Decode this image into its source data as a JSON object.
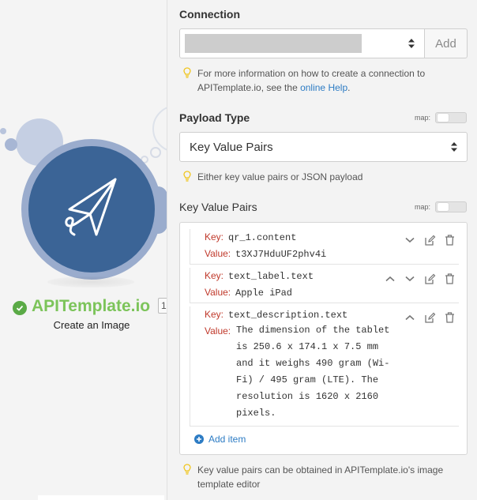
{
  "module": {
    "name": "APITemplate.io",
    "subtitle": "Create an Image",
    "badge": "1",
    "brand_color": "#3b6496",
    "status_color": "#5aaa46",
    "name_color": "#7cc45a"
  },
  "panel": {
    "connection": {
      "label": "Connection",
      "add_label": "Add",
      "hint_prefix": "For more information on how to create a connection to APITemplate.io, see the ",
      "hint_link": "online Help",
      "hint_suffix": "."
    },
    "payload_type": {
      "label": "Payload Type",
      "map_label": "map:",
      "selected": "Key Value Pairs",
      "hint": "Either key value pairs or JSON payload"
    },
    "key_value_pairs": {
      "label": "Key Value Pairs",
      "map_label": "map:",
      "key_label": "Key:",
      "value_label": "Value:",
      "items": [
        {
          "key": "qr_1.content",
          "value": "t3XJ7HduUF2phv4i"
        },
        {
          "key": "text_label.text",
          "value": "Apple iPad"
        },
        {
          "key": "text_description.text",
          "value_lines": [
            "The dimension of the tablet",
            "is 250.6 x 174.1 x 7.5 mm",
            "and it weighs 490 gram (Wi-",
            "Fi) / 495 gram (LTE). The",
            "resolution is 1620 x 2160",
            "pixels."
          ]
        }
      ],
      "add_item_label": "Add item",
      "hint": "Key value pairs can be obtained in APITemplate.io's image template editor"
    }
  },
  "colors": {
    "link": "#2d7cc4",
    "key_label": "#c0392b",
    "bulb": "#f0c419"
  }
}
